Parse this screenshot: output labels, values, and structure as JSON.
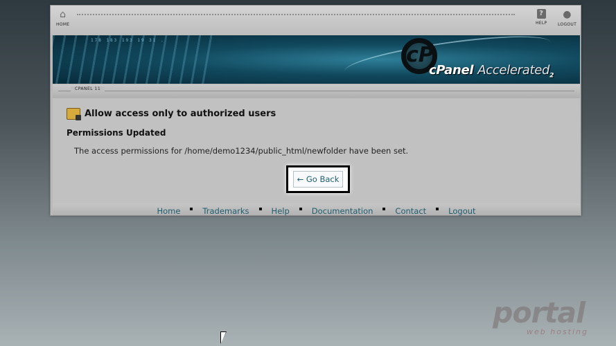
{
  "toolbar": {
    "home_label": "HOME",
    "help_label": "HELP",
    "logout_label": "LOGOUT",
    "home_icon": "home-icon",
    "help_icon": "help-icon",
    "logout_icon": "user-icon"
  },
  "banner": {
    "digits": "178  183  193  19  31  .",
    "logo_letters": "cP",
    "brand_primary": "cPanel",
    "brand_secondary": "Accelerated",
    "brand_version": "2"
  },
  "subbar": {
    "label": "CPANEL 11"
  },
  "page": {
    "title": "Allow access only to authorized users",
    "status_title": "Permissions Updated",
    "message": "The access permissions for /home/demo1234/public_html/newfolder have been set.",
    "back_button": "← Go Back"
  },
  "footer": {
    "links": [
      "Home",
      "Trademarks",
      "Help",
      "Documentation",
      "Contact",
      "Logout"
    ]
  },
  "watermark": {
    "text": "portal",
    "subtext": "web hosting"
  },
  "colors": {
    "link": "#1e5c70",
    "banner_dark": "#072a39",
    "panel_bg": "#c1c1c1"
  }
}
